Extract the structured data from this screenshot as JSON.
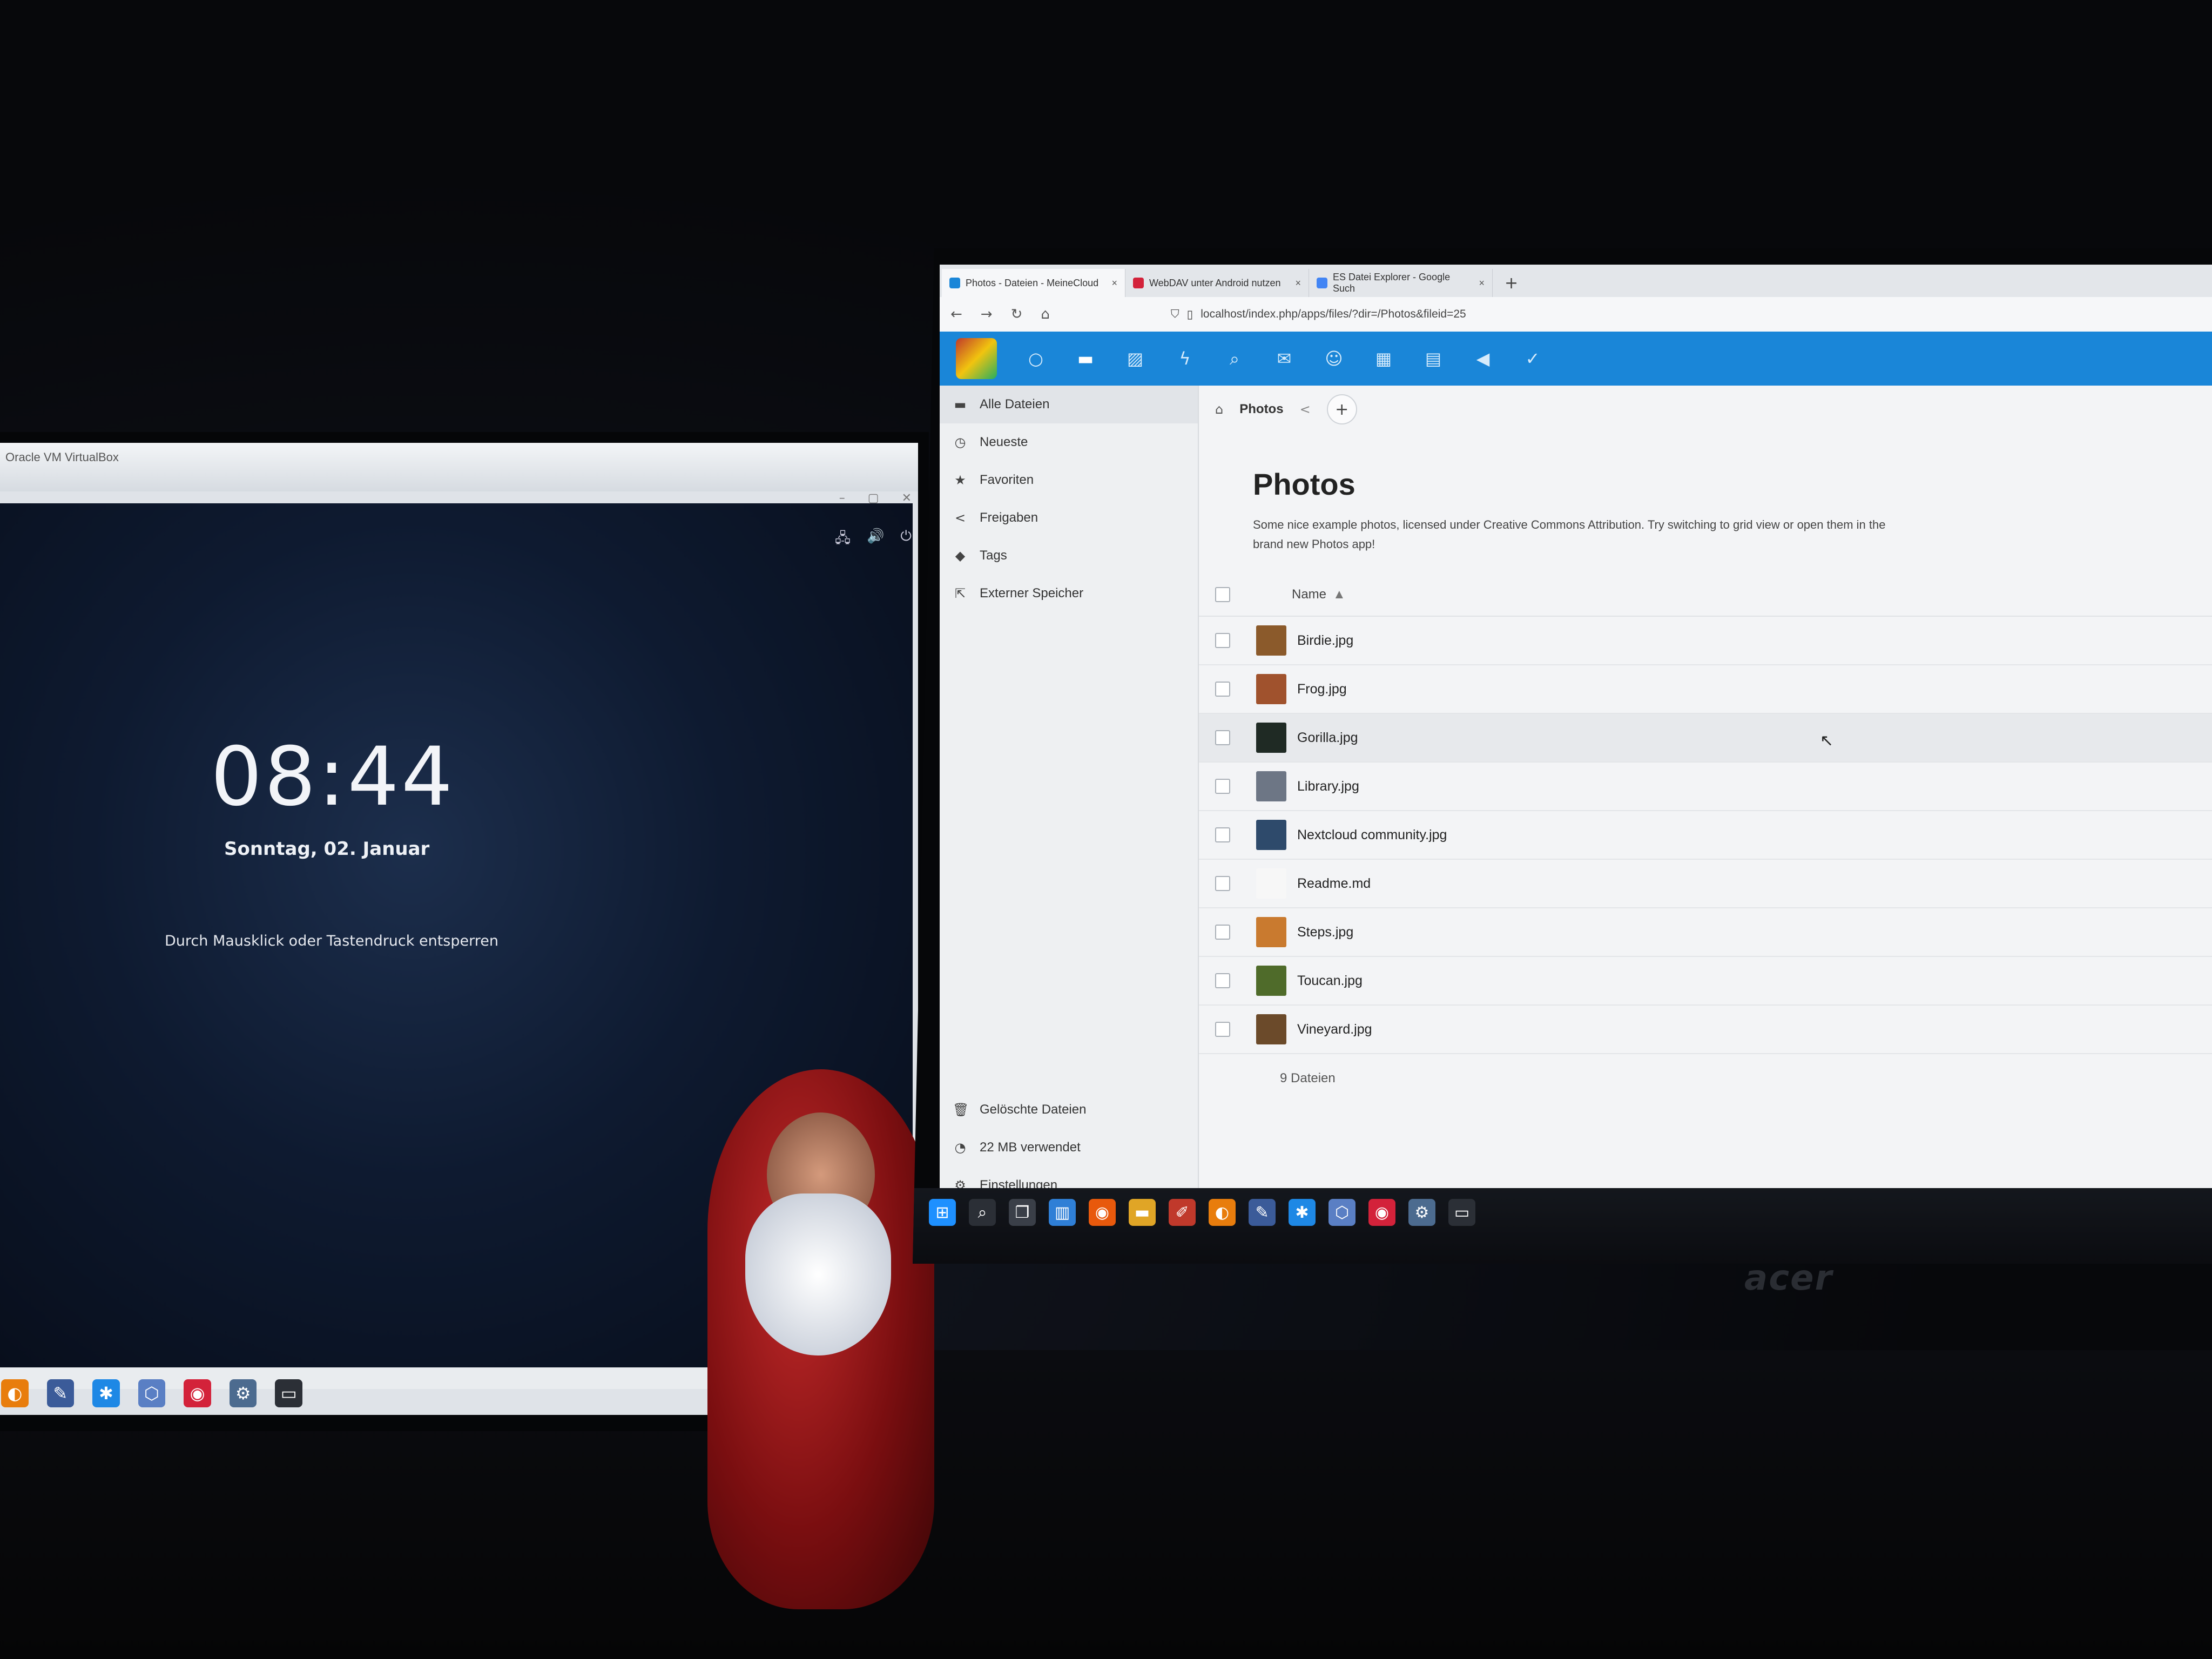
{
  "left_monitor": {
    "window_title": "Oracle VM VirtualBox",
    "window_buttons": [
      "–",
      "▢",
      "✕"
    ],
    "status_icons": [
      "network-icon",
      "audio-icon",
      "power-icon"
    ],
    "status_glyphs": [
      "🖧",
      "🔊",
      "⏻"
    ],
    "lock_screen": {
      "time": "08:44",
      "date": "Sonntag, 02. Januar",
      "hint": "Durch Mausklick oder Tastendruck entsperren"
    },
    "taskbar_icons": [
      {
        "name": "blender-icon",
        "glyph": "◐",
        "color": "#e87d0d"
      },
      {
        "name": "inkscape-icon",
        "glyph": "✎",
        "color": "#3b5b99"
      },
      {
        "name": "network-app-icon",
        "glyph": "✱",
        "color": "#1e88e5"
      },
      {
        "name": "virtualbox-icon",
        "glyph": "⬡",
        "color": "#5a7fc4"
      },
      {
        "name": "app-red-icon",
        "glyph": "◉",
        "color": "#d3223a"
      },
      {
        "name": "settings-icon",
        "glyph": "⚙",
        "color": "#4c6b8f"
      },
      {
        "name": "terminal-icon",
        "glyph": "▭",
        "color": "#2b2f36"
      }
    ]
  },
  "browser": {
    "tabs": [
      {
        "title": "Photos - Dateien - MeineCloud",
        "fav_color": "#1a86d8",
        "active": true
      },
      {
        "title": "WebDAV unter Android nutzen",
        "fav_color": "#d3223a",
        "active": false
      },
      {
        "title": "ES Datei Explorer - Google Such",
        "fav_color": "#4285f4",
        "active": false
      }
    ],
    "tab_close": "×",
    "new_tab": "+",
    "nav_icons": {
      "back": "←",
      "forward": "→",
      "reload": "↻",
      "home": "⌂"
    },
    "url_shield": "⛉",
    "url_page": "▯",
    "url": "localhost/index.php/apps/files/?dir=/Photos&fileid=25"
  },
  "nextcloud": {
    "apps": [
      {
        "name": "dashboard-app-icon",
        "glyph": "○",
        "active": false
      },
      {
        "name": "files-app-icon",
        "glyph": "▬",
        "active": true
      },
      {
        "name": "photos-app-icon",
        "glyph": "▨",
        "active": false
      },
      {
        "name": "activity-app-icon",
        "glyph": "ϟ",
        "active": false
      },
      {
        "name": "search-app-icon",
        "glyph": "⌕",
        "active": false
      },
      {
        "name": "mail-app-icon",
        "glyph": "✉",
        "active": false
      },
      {
        "name": "contacts-app-icon",
        "glyph": "☺",
        "active": false
      },
      {
        "name": "calendar-app-icon",
        "glyph": "▦",
        "active": false
      },
      {
        "name": "deck-app-icon",
        "glyph": "▤",
        "active": false
      },
      {
        "name": "announcements-app-icon",
        "glyph": "◀",
        "active": false
      },
      {
        "name": "tasks-app-icon",
        "glyph": "✓",
        "active": false
      }
    ],
    "sidebar": {
      "items": [
        {
          "label": "Alle Dateien",
          "glyph": "▬",
          "icon": "folder-icon",
          "active": true
        },
        {
          "label": "Neueste",
          "glyph": "◷",
          "icon": "clock-icon",
          "active": false
        },
        {
          "label": "Favoriten",
          "glyph": "★",
          "icon": "star-icon",
          "active": false
        },
        {
          "label": "Freigaben",
          "glyph": "<",
          "icon": "share-icon",
          "active": false
        },
        {
          "label": "Tags",
          "glyph": "◆",
          "icon": "tag-icon",
          "active": false
        },
        {
          "label": "Externer Speicher",
          "glyph": "⇱",
          "icon": "external-storage-icon",
          "active": false
        }
      ],
      "bottom_items": [
        {
          "label": "Gelöschte Dateien",
          "glyph": "🗑",
          "icon": "trash-icon"
        },
        {
          "label": "22 MB verwendet",
          "glyph": "◔",
          "icon": "quota-icon"
        },
        {
          "label": "Einstellungen",
          "glyph": "⚙",
          "icon": "settings-icon"
        }
      ]
    },
    "breadcrumb": {
      "home_glyph": "⌂",
      "folder": "Photos",
      "share_glyph": "<",
      "add_glyph": "+"
    },
    "folder": {
      "title": "Photos",
      "description": "Some nice example photos, licensed under Creative Commons Attribution. Try switching to grid view or open them in the brand new Photos app!"
    },
    "table": {
      "header_name": "Name",
      "sort_indicator": "▲",
      "files": [
        {
          "name": "Birdie.jpg",
          "thumb_color": "#8b5a2b"
        },
        {
          "name": "Frog.jpg",
          "thumb_color": "#a0522d"
        },
        {
          "name": "Gorilla.jpg",
          "thumb_color": "#1f2a24"
        },
        {
          "name": "Library.jpg",
          "thumb_color": "#6d7685"
        },
        {
          "name": "Nextcloud community.jpg",
          "thumb_color": "#2e4a6b"
        },
        {
          "name": "Readme.md",
          "thumb_color": "#f7f7f7"
        },
        {
          "name": "Steps.jpg",
          "thumb_color": "#c97a2f"
        },
        {
          "name": "Toucan.jpg",
          "thumb_color": "#4f6b2a"
        },
        {
          "name": "Vineyard.jpg",
          "thumb_color": "#6b4a2a"
        }
      ],
      "summary": "9 Dateien"
    },
    "cursor_glyph": "↖"
  },
  "windows_taskbar": [
    {
      "name": "windows-start-icon",
      "glyph": "⊞",
      "color": "#1e90ff"
    },
    {
      "name": "search-icon",
      "glyph": "⌕",
      "color": "#2b2f36"
    },
    {
      "name": "task-view-icon",
      "glyph": "❐",
      "color": "#3a3f48"
    },
    {
      "name": "widgets-icon",
      "glyph": "▥",
      "color": "#2f7fd6"
    },
    {
      "name": "firefox-icon",
      "glyph": "◉",
      "color": "#e8590c"
    },
    {
      "name": "explorer-icon",
      "glyph": "▬",
      "color": "#e0a526"
    },
    {
      "name": "paint-icon",
      "glyph": "✐",
      "color": "#c0392b"
    },
    {
      "name": "blender-icon",
      "glyph": "◐",
      "color": "#e87d0d"
    },
    {
      "name": "inkscape-icon",
      "glyph": "✎",
      "color": "#3b5b99"
    },
    {
      "name": "network-app-icon",
      "glyph": "✱",
      "color": "#1e88e5"
    },
    {
      "name": "virtualbox-icon",
      "glyph": "⬡",
      "color": "#5a7fc4"
    },
    {
      "name": "app-red-icon",
      "glyph": "◉",
      "color": "#d3223a"
    },
    {
      "name": "settings-icon",
      "glyph": "⚙",
      "color": "#4c6b8f"
    },
    {
      "name": "terminal-icon",
      "glyph": "▭",
      "color": "#2b2f36"
    }
  ],
  "monitor_brand": "acer"
}
